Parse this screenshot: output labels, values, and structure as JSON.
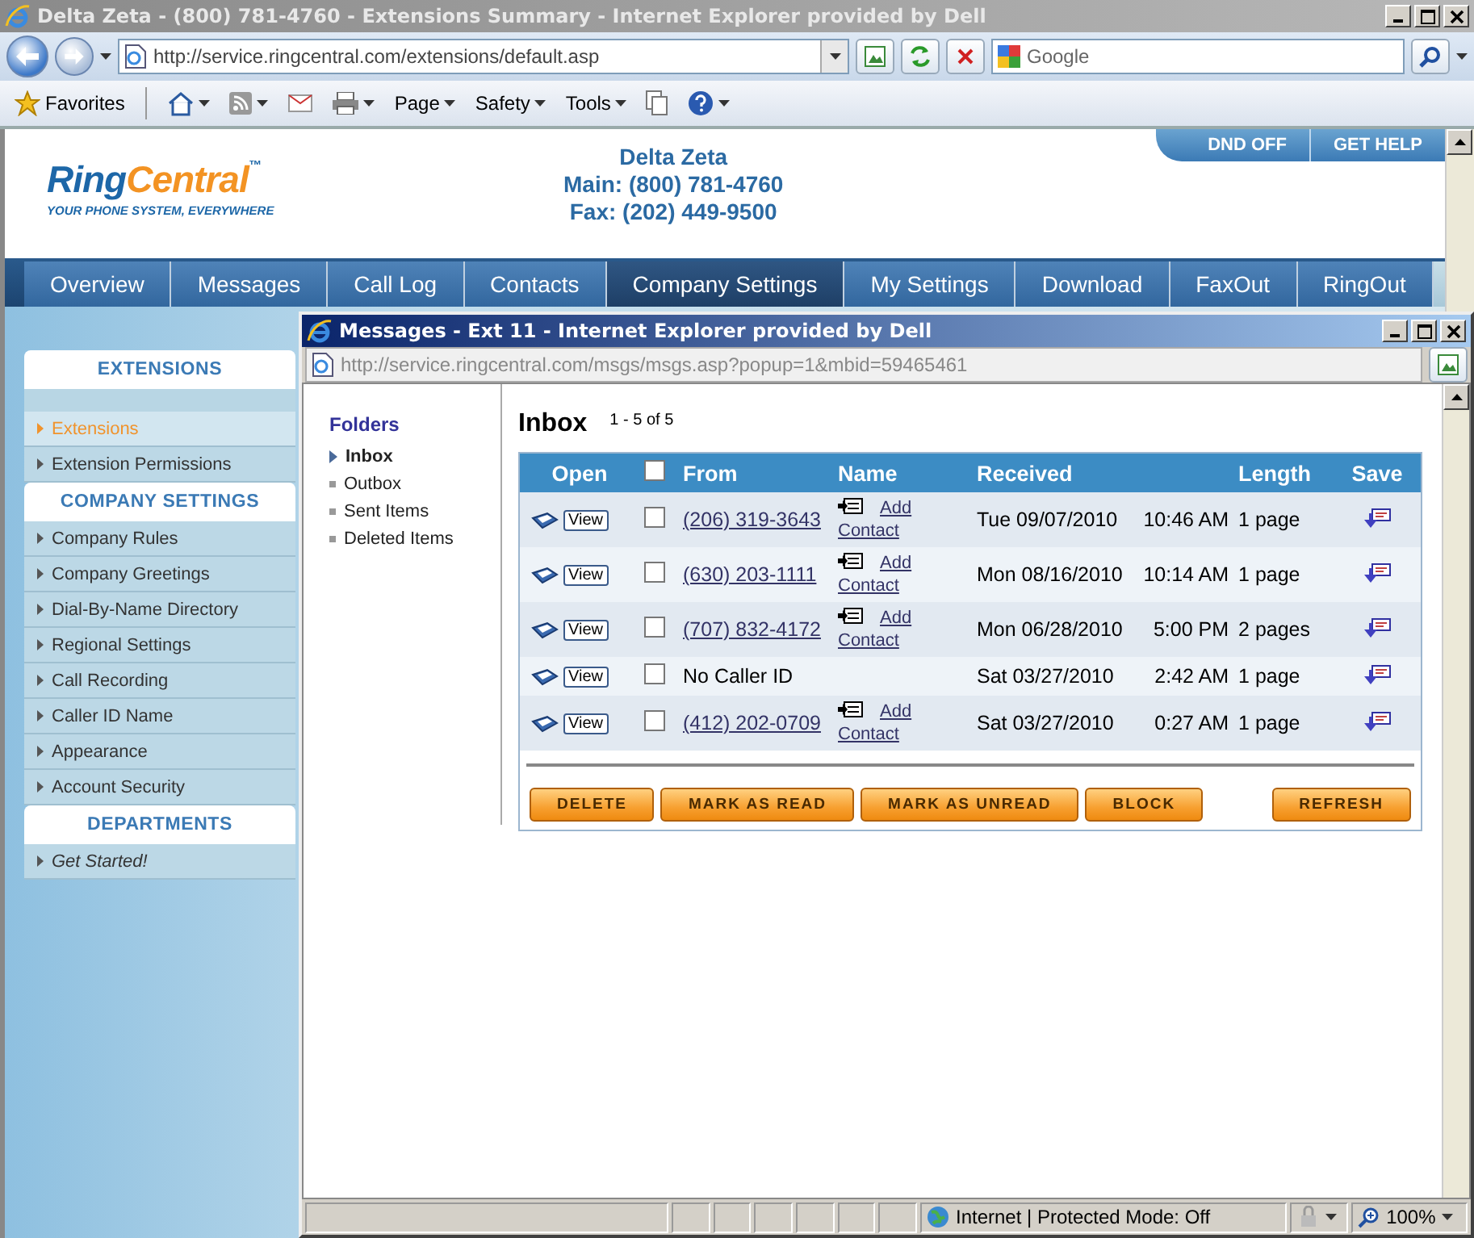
{
  "browser": {
    "title": "Delta Zeta - (800) 781-4760 - Extensions Summary - Internet Explorer provided by Dell",
    "address": "http://service.ringcentral.com/extensions/default.asp",
    "search_placeholder": "Google",
    "favorites": "Favorites",
    "menus": [
      "Page",
      "Safety",
      "Tools"
    ]
  },
  "page": {
    "logo": {
      "parts": [
        "Ring",
        "Central"
      ],
      "tm": "™",
      "tagline": "YOUR PHONE SYSTEM, EVERYWHERE"
    },
    "account": [
      "Delta Zeta",
      "Main: (800) 781-4760",
      "Fax: (202) 449-9500"
    ],
    "top_links": [
      "DND OFF",
      "GET HELP"
    ],
    "nav": [
      {
        "label": "Overview",
        "selected": false
      },
      {
        "label": "Messages",
        "selected": false
      },
      {
        "label": "Call Log",
        "selected": false
      },
      {
        "label": "Contacts",
        "selected": false
      },
      {
        "label": "Company Settings",
        "selected": true
      },
      {
        "label": "My Settings",
        "selected": false
      },
      {
        "label": "Download",
        "selected": false
      },
      {
        "label": "FaxOut",
        "selected": false
      },
      {
        "label": "RingOut",
        "selected": false
      }
    ],
    "sidebar": [
      {
        "heading": "EXTENSIONS",
        "items": [
          {
            "label": "Extensions",
            "selected": true,
            "italic": false
          },
          {
            "label": "Extension Permissions",
            "selected": false,
            "italic": false
          }
        ]
      },
      {
        "heading": "COMPANY SETTINGS",
        "items": [
          {
            "label": "Company Rules",
            "selected": false,
            "italic": false
          },
          {
            "label": "Company Greetings",
            "selected": false,
            "italic": false
          },
          {
            "label": "Dial-By-Name Directory",
            "selected": false,
            "italic": false
          },
          {
            "label": "Regional Settings",
            "selected": false,
            "italic": false
          },
          {
            "label": "Call Recording",
            "selected": false,
            "italic": false
          },
          {
            "label": "Caller ID Name",
            "selected": false,
            "italic": false
          },
          {
            "label": "Appearance",
            "selected": false,
            "italic": false
          },
          {
            "label": "Account Security",
            "selected": false,
            "italic": false
          }
        ]
      },
      {
        "heading": "DEPARTMENTS",
        "items": [
          {
            "label": "Get Started!",
            "selected": false,
            "italic": true
          }
        ]
      }
    ]
  },
  "popup": {
    "title": "Messages - Ext 11 - Internet Explorer provided by Dell",
    "address": "http://service.ringcentral.com/msgs/msgs.asp?popup=1&mbid=59465461",
    "folders": {
      "heading": "Folders",
      "items": [
        {
          "label": "Inbox",
          "selected": true
        },
        {
          "label": "Outbox",
          "selected": false
        },
        {
          "label": "Sent Items",
          "selected": false
        },
        {
          "label": "Deleted Items",
          "selected": false
        }
      ]
    },
    "inbox": {
      "title": "Inbox",
      "count": "1 - 5 of 5",
      "columns": [
        "Open",
        "From",
        "Name",
        "Received",
        "Length",
        "Save"
      ],
      "select_all_checked": false,
      "rows": [
        {
          "view": "View",
          "checked": false,
          "from": "(206) 319-3643",
          "kind": "number",
          "add_contact": "Add Contact",
          "date": "Tue 09/07/2010",
          "time": "10:46 AM",
          "length": "1 page"
        },
        {
          "view": "View",
          "checked": false,
          "from": "(630) 203-1111",
          "kind": "number",
          "add_contact": "Add Contact",
          "date": "Mon 08/16/2010",
          "time": "10:14 AM",
          "length": "1 page"
        },
        {
          "view": "View",
          "checked": false,
          "from": "(707) 832-4172",
          "kind": "number",
          "add_contact": "Add Contact",
          "date": "Mon 06/28/2010",
          "time": "5:00 PM",
          "length": "2 pages"
        },
        {
          "view": "View",
          "checked": false,
          "from": "No Caller ID",
          "kind": "unknown",
          "date": "Sat 03/27/2010",
          "time": "2:42 AM",
          "length": "1 page"
        },
        {
          "view": "View",
          "checked": false,
          "from": "(412) 202-0709",
          "kind": "number",
          "add_contact": "Add Contact",
          "date": "Sat 03/27/2010",
          "time": "0:27 AM",
          "length": "1 page"
        }
      ],
      "buttons": [
        "DELETE",
        "MARK AS READ",
        "MARK AS UNREAD",
        "BLOCK"
      ],
      "refresh": "REFRESH"
    },
    "status_bar": {
      "zone": "Internet | Protected Mode: Off",
      "zoom": "100%"
    }
  }
}
